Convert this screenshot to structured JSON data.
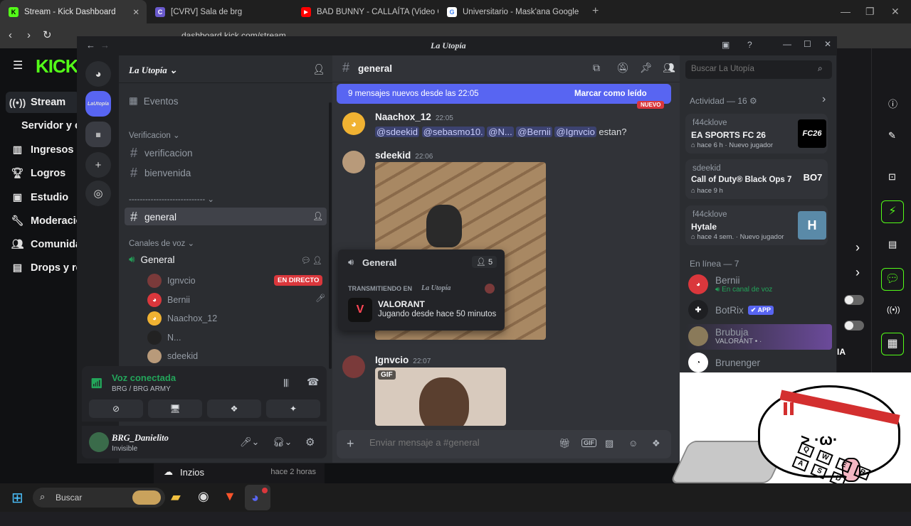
{
  "browser": {
    "tabs": [
      {
        "label": "Stream - Kick Dashboard",
        "active": true
      },
      {
        "label": "[CVRV] Sala de brg",
        "active": false
      },
      {
        "label": "BAD BUNNY - CALLAÍTA (Video Ofici",
        "active": false
      },
      {
        "label": "Universitario - Mask'ana Google",
        "active": false
      }
    ],
    "url": "dashboard.kick.com/stream"
  },
  "kick": {
    "logo": "KICK",
    "nav": [
      {
        "label": "Stream",
        "icon": "stream-icon"
      },
      {
        "label": "Servidor y c",
        "icon": ""
      },
      {
        "label": "Ingresos",
        "icon": "chart-icon"
      },
      {
        "label": "Logros",
        "icon": "trophy-icon"
      },
      {
        "label": "Estudio",
        "icon": "studio-icon"
      },
      {
        "label": "Moderacio",
        "icon": "wrench-icon"
      },
      {
        "label": "Comunida",
        "icon": "people-icon"
      },
      {
        "label": "Drops y re",
        "icon": "drops-icon"
      }
    ],
    "bottom_row": {
      "label": "Inzios",
      "time": "hace 2 horas"
    },
    "overlay_text_ia": "IA"
  },
  "discord": {
    "window_title": "La Utopía",
    "server_name": "La Utopía",
    "server_badge": "LaUtopía",
    "channels": {
      "events": "Eventos",
      "cat_verification": "Verificacion",
      "verification": "verificacion",
      "welcome": "bienvenida",
      "divider": "----------------------------",
      "general": "general",
      "cat_voice": "Canales de voz",
      "voice_general": "General",
      "voice_users": [
        {
          "name": "Ignvcio",
          "badge": "EN DIRECTO"
        },
        {
          "name": "Bernii",
          "badge": ""
        },
        {
          "name": "Naachox_12",
          "badge": ""
        },
        {
          "name": "N...",
          "badge": ""
        },
        {
          "name": "sdeekid",
          "badge": ""
        }
      ]
    },
    "voice_panel": {
      "status": "Voz conectada",
      "location": "BRG / BRG ARMY"
    },
    "user_panel": {
      "name": "BRG_Danielito",
      "status": "Invisible"
    },
    "chat": {
      "channel": "general",
      "new_banner": "9 mensajes nuevos desde las 22:05",
      "mark_read": "Marcar como leído",
      "new_tag": "NUEVO",
      "messages": [
        {
          "author": "Naachox_12",
          "time": "22:05",
          "mentions": [
            "@sdeekid",
            "@sebasmo10.",
            "@N...",
            "@Bernii",
            "@Ignvcio"
          ],
          "text": "estan?"
        },
        {
          "author": "sdeekid",
          "time": "22:06"
        },
        {
          "author": "Ignvcio",
          "time": "22:07",
          "gif": "GIF"
        }
      ],
      "input_placeholder": "Enviar mensaje a #general",
      "popup": {
        "channel": "General",
        "count": "5",
        "streaming_in": "TRANSMITIENDO EN",
        "server": "La Utopía",
        "game": "VALORANT",
        "playing": "Jugando desde hace 50 minutos"
      }
    },
    "search_placeholder": "Buscar La Utopía",
    "activity": {
      "header": "Actividad — 16",
      "cards": [
        {
          "user": "f44cklove",
          "game": "EA SPORTS FC 26",
          "time": "hace 6 h",
          "tag": "Nuevo jugador",
          "thumb": "FC26"
        },
        {
          "user": "sdeekid",
          "game": "Call of Duty® Black Ops 7",
          "time": "hace 9 h",
          "tag": "",
          "thumb": "BO7"
        },
        {
          "user": "f44cklove",
          "game": "Hytale",
          "time": "hace 4 sem.",
          "tag": "Nuevo jugador",
          "thumb": "H"
        }
      ]
    },
    "online": {
      "header": "En línea — 7",
      "members": [
        {
          "name": "Bernii",
          "sub": "En canal de voz",
          "tag": ""
        },
        {
          "name": "BotRix",
          "sub": "",
          "tag": "APP"
        },
        {
          "name": "Brubuja",
          "sub": "VALORANT • ·",
          "tag": ""
        },
        {
          "name": "Brunenger",
          "sub": "",
          "tag": ""
        }
      ]
    }
  },
  "taskbar": {
    "search": "Buscar"
  },
  "overlay": {
    "keyboard_keys": [
      "Q",
      "W",
      "E",
      "R",
      "A",
      "S",
      "D"
    ]
  },
  "colors": {
    "kick_green": "#53fc18",
    "discord_blurple": "#5865f2",
    "live_red": "#da373c",
    "online_green": "#23a55a"
  }
}
